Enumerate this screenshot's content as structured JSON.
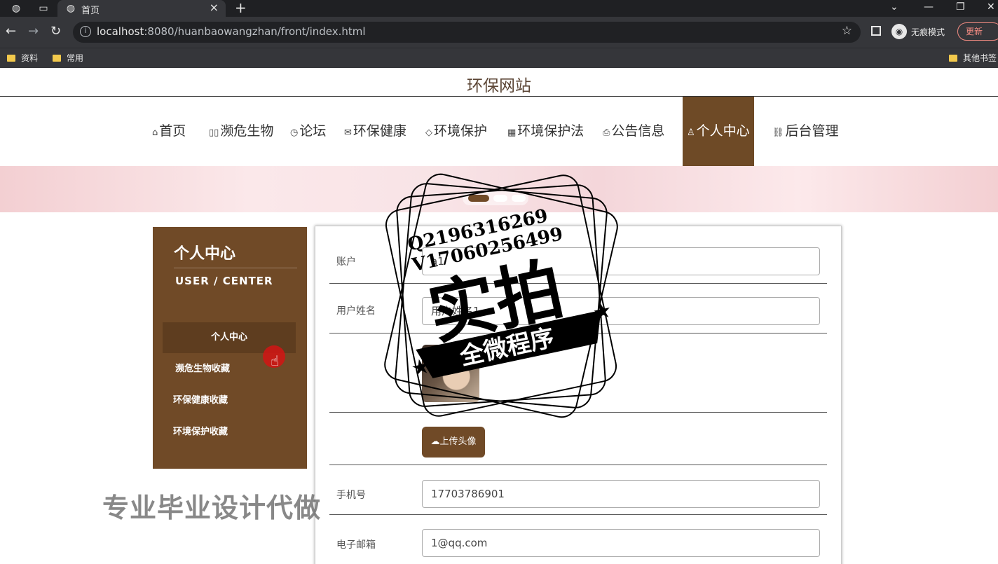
{
  "browser": {
    "tab_title": "首页",
    "url_host": "localhost",
    "url_rest": ":8080/huanbaowangzhan/front/index.html",
    "incognito_label": "无痕模式",
    "update_label": "更新",
    "bookmarks": [
      "资料",
      "常用"
    ],
    "bookmarks_other": "其他书签"
  },
  "site": {
    "title": "环保网站",
    "nav": [
      {
        "label": "首页",
        "icon": "home-icon"
      },
      {
        "label": "濒危生物",
        "icon": "columns-icon"
      },
      {
        "label": "论坛",
        "icon": "clock-icon"
      },
      {
        "label": "环保健康",
        "icon": "mail-icon"
      },
      {
        "label": "环境保护",
        "icon": "tag-icon"
      },
      {
        "label": "环境保护法",
        "icon": "grid-icon"
      },
      {
        "label": "公告信息",
        "icon": "printer-icon"
      },
      {
        "label": "个人中心",
        "icon": "user-icon"
      },
      {
        "label": "后台管理",
        "icon": "link-icon"
      }
    ]
  },
  "sidebar": {
    "title": "个人中心",
    "subtitle": "USER / CENTER",
    "items": [
      "个人中心",
      "濒危生物收藏",
      "环保健康收藏",
      "环境保护收藏"
    ]
  },
  "form": {
    "account_label": "账户",
    "account_value": "a1",
    "name_label": "用户姓名",
    "name_value": "用户姓名1",
    "upload_label": "上传头像",
    "phone_label": "手机号",
    "phone_value": "17703786901",
    "email_label": "电子邮箱",
    "email_value": "1@qq.com"
  },
  "watermark": {
    "qq": "Q2196316269",
    "wx": "V17060256499",
    "main": "实拍",
    "sub": "全微程序",
    "footer": "专业毕业设计代做"
  },
  "colors": {
    "brand_brown": "#704a27",
    "chrome_dark": "#35363a"
  }
}
